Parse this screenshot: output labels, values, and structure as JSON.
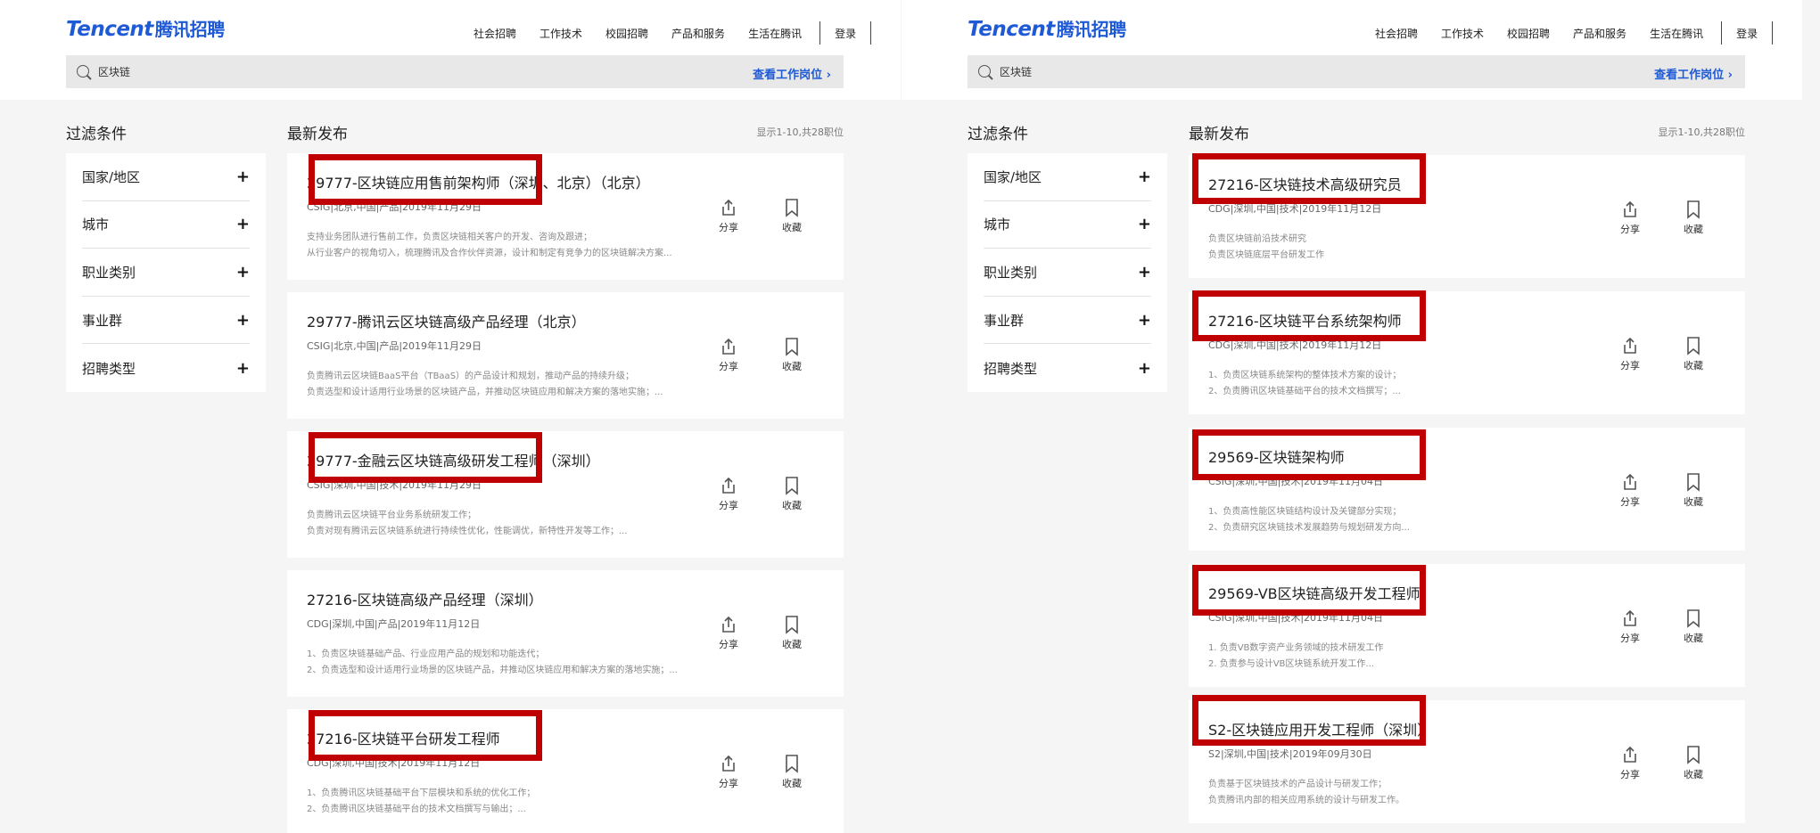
{
  "brand": {
    "en": "Tencent",
    "cn": "腾讯招聘"
  },
  "nav": {
    "items": [
      "社会招聘",
      "工作技术",
      "校园招聘",
      "产品和服务",
      "生活在腾讯"
    ],
    "login": "登录"
  },
  "search": {
    "value": "区块链",
    "link": "查看工作岗位 ›"
  },
  "filters": {
    "title": "过滤条件",
    "items": [
      "国家/地区",
      "城市",
      "职业类别",
      "事业群",
      "招聘类型"
    ]
  },
  "list": {
    "title": "最新发布"
  },
  "actions": {
    "share": "分享",
    "favorite": "收藏"
  },
  "colors": {
    "brand": "#1f5ad6",
    "highlight": "#c00000"
  },
  "left": {
    "count": "显示1-10,共28职位",
    "jobs": [
      {
        "title": "29777-区块链应用售前架构师（深圳、北京）（北京）",
        "meta": "CSIG|北京,中国|产品|2019年11月29日",
        "desc": [
          "支持业务团队进行售前工作，负责区块链相关客户的开发、咨询及跟进；",
          "从行业客户的视角切入，梳理腾讯及合作伙伴资源，设计和制定有竞争力的区块链解决方案..."
        ]
      },
      {
        "title": "29777-腾讯云区块链高级产品经理（北京）",
        "meta": "CSIG|北京,中国|产品|2019年11月29日",
        "desc": [
          "负责腾讯云区块链BaaS平台（TBaaS）的产品设计和规划，推动产品的持续升级；",
          "负责选型和设计适用行业场景的区块链产品，并推动区块链应用和解决方案的落地实施；..."
        ]
      },
      {
        "title": "29777-金融云区块链高级研发工程师（深圳）",
        "meta": "CSIG|深圳,中国|技术|2019年11月29日",
        "desc": [
          "负责腾讯云区块链平台业务系统研发工作；",
          "负责对现有腾讯云区块链系统进行持续性优化，性能调优，新特性开发等工作；..."
        ]
      },
      {
        "title": "27216-区块链高级产品经理（深圳）",
        "meta": "CDG|深圳,中国|产品|2019年11月12日",
        "desc": [
          "1、负责区块链基础产品、行业应用产品的规划和功能迭代；",
          "2、负责选型和设计适用行业场景的区块链产品，并推动区块链应用和解决方案的落地实施；..."
        ]
      },
      {
        "title": "27216-区块链平台研发工程师",
        "meta": "CDG|深圳,中国|技术|2019年11月12日",
        "desc": [
          "1、负责腾讯区块链基础平台下层模块和系统的优化工作；",
          "2、负责腾讯区块链基础平台的技术文档撰写与输出；..."
        ]
      }
    ]
  },
  "right": {
    "count": "显示1-10,共28职位",
    "jobs": [
      {
        "title": "27216-区块链技术高级研究员",
        "meta": "CDG|深圳,中国|技术|2019年11月12日",
        "desc": [
          "负责区块链前沿技术研究",
          "负责区块链底层平台研发工作"
        ]
      },
      {
        "title": "27216-区块链平台系统架构师",
        "meta": "CDG|深圳,中国|技术|2019年11月12日",
        "desc": [
          "1、负责区块链系统架构的整体技术方案的设计；",
          "2、负责腾讯区块链基础平台的技术文档撰写；..."
        ]
      },
      {
        "title": "29569-区块链架构师",
        "meta": "CSIG|深圳,中国|技术|2019年11月04日",
        "desc": [
          "1、负责高性能区块链结构设计及关键部分实现；",
          "2、负责研究区块链技术发展趋势与规划研发方向..."
        ]
      },
      {
        "title": "29569-VB区块链高级开发工程师",
        "meta": "CSIG|深圳,中国|技术|2019年11月04日",
        "desc": [
          "1. 负责VB数字资产业务领域的技术研发工作",
          "2. 负责参与设计VB区块链系统开发工作..."
        ]
      },
      {
        "title": "S2-区块链应用开发工程师（深圳）",
        "meta": "S2|深圳,中国|技术|2019年09月30日",
        "desc": [
          "负责基于区块链技术的产品设计与研发工作；",
          "负责腾讯内部的相关应用系统的设计与研发工作。"
        ]
      }
    ]
  }
}
